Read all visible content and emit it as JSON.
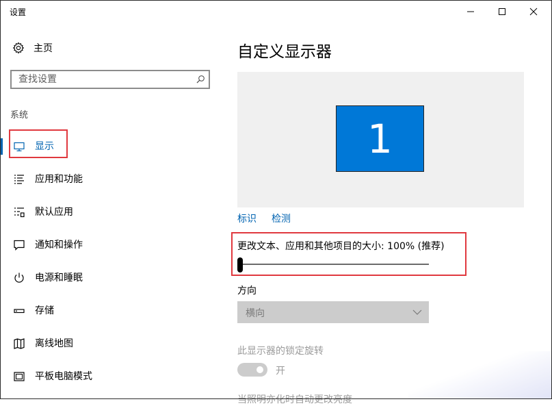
{
  "window": {
    "title": "设置"
  },
  "sidebar": {
    "home_label": "主页",
    "search": {
      "placeholder": "查找设置"
    },
    "section_label": "系统",
    "items": [
      {
        "label": "显示",
        "icon": "monitor-icon",
        "active": true
      },
      {
        "label": "应用和功能",
        "icon": "app-list-icon"
      },
      {
        "label": "默认应用",
        "icon": "default-apps-icon"
      },
      {
        "label": "通知和操作",
        "icon": "notification-icon"
      },
      {
        "label": "电源和睡眠",
        "icon": "power-icon"
      },
      {
        "label": "存储",
        "icon": "storage-icon"
      },
      {
        "label": "离线地图",
        "icon": "map-icon"
      },
      {
        "label": "平板电脑模式",
        "icon": "tablet-icon"
      }
    ]
  },
  "main": {
    "title": "自定义显示器",
    "monitor_number": "1",
    "identify_link": "标识",
    "detect_link": "检测",
    "scale": {
      "label": "更改文本、应用和其他项目的大小: 100% (推荐)",
      "level_fraction": 0.0
    },
    "orientation": {
      "label": "方向",
      "value": "横向"
    },
    "rotation_lock": {
      "label": "此显示器的锁定旋转",
      "toggle_label": "开",
      "enabled": false
    },
    "cutoff_label": "当照明亦化时自动更改亮度"
  },
  "colors": {
    "accent": "#0063b1",
    "monitor_fill": "#0078d7",
    "highlight_box": "#e0383e"
  }
}
